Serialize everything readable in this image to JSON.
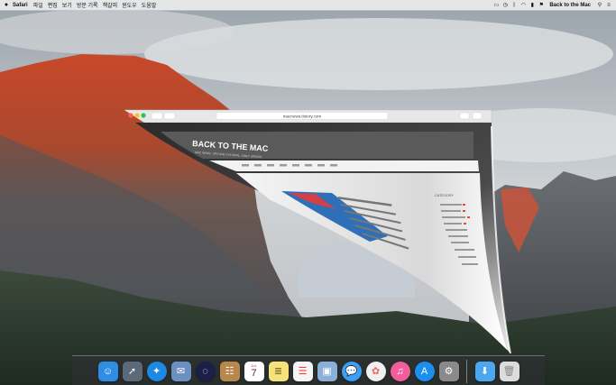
{
  "menubar": {
    "apple_icon": "apple-icon",
    "app_name": "Safari",
    "menus": [
      "파일",
      "편집",
      "보기",
      "방문 기록",
      "책갈피",
      "윈도우",
      "도움말"
    ],
    "status_icons": [
      "display-mirror-icon",
      "time-machine-icon",
      "bluetooth-icon",
      "wifi-icon",
      "battery-icon",
      "flag-icon"
    ],
    "user_name": "Back to the Mac",
    "spotlight_icon": "search-icon",
    "notification_icon": "list-icon"
  },
  "safari_window": {
    "address": "macnews.tistory.com",
    "site_title": "BACK TO THE MAC",
    "site_tagline": "MAC NEWS, TIPS AND TUTORIAL, DAILY UPDATE",
    "sidebar_heading": "CATEGORY",
    "state": "page-curl-animation"
  },
  "dock": {
    "apps": [
      {
        "name": "Finder",
        "icon": "finder-icon",
        "color": "#2f8de4"
      },
      {
        "name": "Launchpad",
        "icon": "launchpad-icon",
        "color": "#5b6a7a"
      },
      {
        "name": "Safari",
        "icon": "safari-icon",
        "color": "#1e88e5"
      },
      {
        "name": "Mail",
        "icon": "mail-icon",
        "color": "#6a8fc0"
      },
      {
        "name": "Siri",
        "icon": "siri-icon",
        "color": "#1b1f4a"
      },
      {
        "name": "Contacts",
        "icon": "contacts-icon",
        "color": "#b8874b"
      },
      {
        "name": "Calendar",
        "icon": "calendar-icon",
        "color": "#ffffff",
        "month": "JUL",
        "day": "7"
      },
      {
        "name": "Notes",
        "icon": "notes-icon",
        "color": "#f6e27a"
      },
      {
        "name": "Reminders",
        "icon": "reminders-icon",
        "color": "#f4f4f4"
      },
      {
        "name": "Preview",
        "icon": "preview-icon",
        "color": "#8ab0d8"
      },
      {
        "name": "Messages",
        "icon": "messages-icon",
        "color": "#3ba0f5"
      },
      {
        "name": "Photos",
        "icon": "photos-icon",
        "color": "#f0f0f0"
      },
      {
        "name": "iTunes",
        "icon": "itunes-icon",
        "color": "#f25d9c"
      },
      {
        "name": "App Store",
        "icon": "app-store-icon",
        "color": "#1c8ef0"
      },
      {
        "name": "System Preferences",
        "icon": "system-preferences-icon",
        "color": "#8a8a8a"
      }
    ],
    "right_items": [
      {
        "name": "Downloads",
        "icon": "folder-icon",
        "color": "#4aa7f0"
      },
      {
        "name": "Trash",
        "icon": "trash-icon",
        "color": "#dcdcdc"
      }
    ]
  }
}
